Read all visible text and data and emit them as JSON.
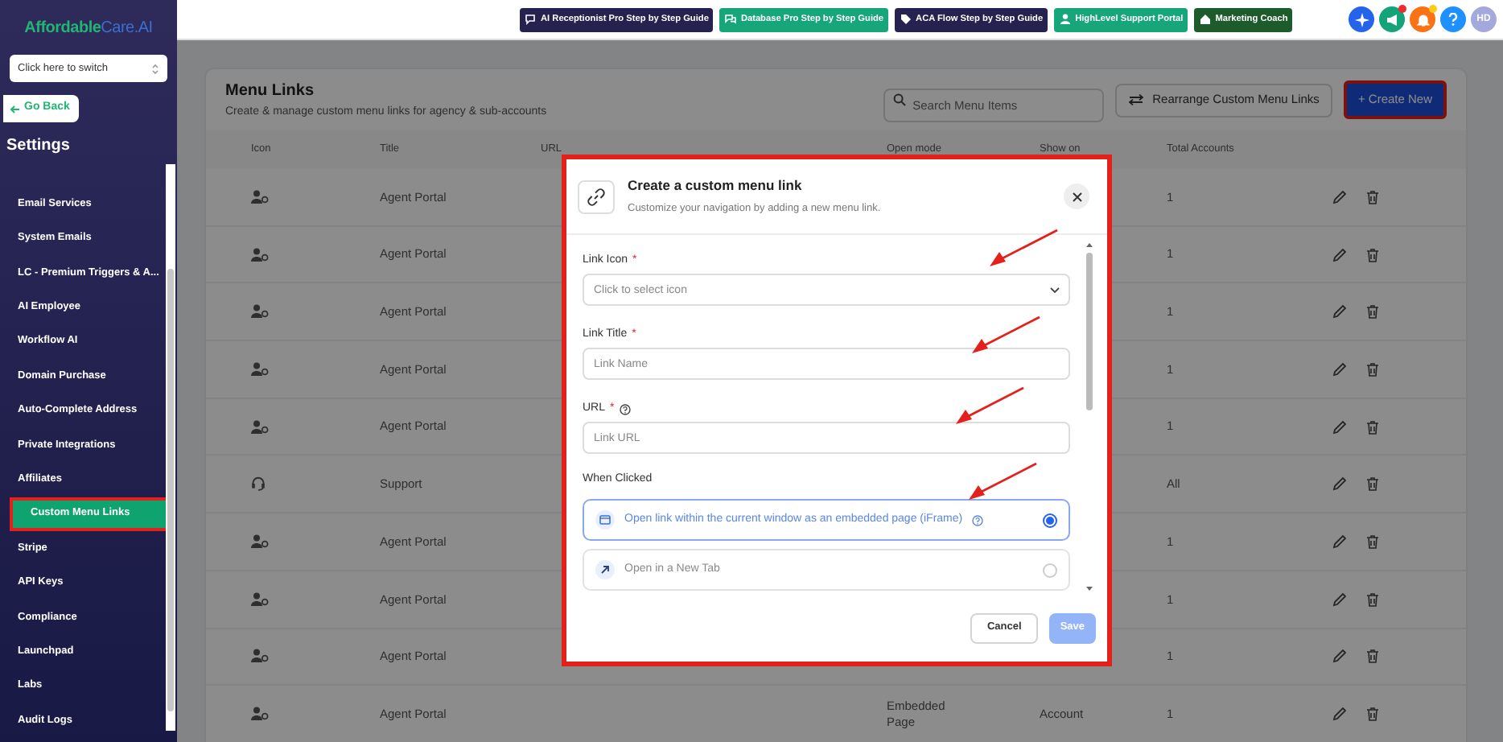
{
  "sidebar": {
    "logo": {
      "part_1": "Affordable",
      "part_2": "Care.AI"
    },
    "switcher": {
      "placeholder": "Click here to switch"
    },
    "back_button": "Go Back",
    "heading": "Settings",
    "items": [
      {
        "label": "Email Services",
        "selected": false
      },
      {
        "label": "System Emails",
        "selected": false
      },
      {
        "label": "LC - Premium Triggers & A...",
        "selected": false
      },
      {
        "label": "AI Employee",
        "selected": false
      },
      {
        "label": "Workflow AI",
        "selected": false
      },
      {
        "label": "Domain Purchase",
        "selected": false
      },
      {
        "label": "Auto-Complete Address",
        "selected": false
      },
      {
        "label": "Private Integrations",
        "selected": false
      },
      {
        "label": "Affiliates",
        "selected": false
      },
      {
        "label": "Custom Menu Links",
        "selected": true
      },
      {
        "label": "Stripe",
        "selected": false
      },
      {
        "label": "API Keys",
        "selected": false
      },
      {
        "label": "Compliance",
        "selected": false
      },
      {
        "label": "Launchpad",
        "selected": false
      },
      {
        "label": "Labs",
        "selected": false
      },
      {
        "label": "Audit Logs",
        "selected": false
      }
    ]
  },
  "top_bar": {
    "guides": [
      {
        "label": "AI Receptionist Pro Step by Step Guide",
        "kind": "chat",
        "color": "#25224f"
      },
      {
        "label": "Database Pro Step by Step Guide",
        "kind": "chats",
        "color": "#17a57a"
      },
      {
        "label": "ACA Flow Step by Step Guide",
        "kind": "tag",
        "color": "#25224f"
      },
      {
        "label": "HighLevel Support Portal",
        "kind": "person",
        "color": "#17a57a"
      },
      {
        "label": "Marketing Coach",
        "kind": "home",
        "color": "#1d5a2c"
      }
    ],
    "avatar": "HD"
  },
  "page": {
    "title": "Menu Links",
    "subtitle": "Create & manage custom menu links for agency & sub-accounts",
    "search": {
      "placeholder": "Search Menu Items"
    },
    "rearrange_button": "Rearrange Custom Menu Links",
    "create_button": "+ Create New",
    "table": {
      "columns": [
        "Icon",
        "Title",
        "URL",
        "Open mode",
        "Show on",
        "Total Accounts"
      ],
      "rows": [
        {
          "kind": "agent",
          "title": "Agent Portal",
          "total": "1"
        },
        {
          "kind": "agent",
          "title": "Agent Portal",
          "total": "1"
        },
        {
          "kind": "agent",
          "title": "Agent Portal",
          "total": "1"
        },
        {
          "kind": "agent",
          "title": "Agent Portal",
          "total": "1"
        },
        {
          "kind": "agent",
          "title": "Agent Portal",
          "total": "1"
        },
        {
          "kind": "support",
          "title": "Support",
          "total": "All"
        },
        {
          "kind": "agent",
          "title": "Agent Portal",
          "total": "1"
        },
        {
          "kind": "agent",
          "title": "Agent Portal",
          "total": "1"
        },
        {
          "kind": "agent",
          "title": "Agent Portal",
          "total": "1"
        },
        {
          "kind": "agent",
          "title": "Agent Portal",
          "open_mode": "Embedded Page",
          "show_on": "Account",
          "total": "1"
        }
      ]
    }
  },
  "dialog": {
    "title": "Create a custom menu link",
    "subtitle": "Customize your navigation by adding a new menu link.",
    "fields": [
      {
        "label": "Link Icon",
        "required": "*",
        "kind": "select",
        "placeholder": "Click to select icon"
      },
      {
        "label": "Link Title",
        "required": "*",
        "kind": "text",
        "placeholder": "Link Name"
      },
      {
        "label": "URL",
        "required": "*",
        "kind": "text",
        "help": true,
        "placeholder": "Link URL"
      }
    ],
    "when_clicked": {
      "label": "When Clicked",
      "options": [
        {
          "label": "Open link within the current window as an embedded page (iFrame)",
          "kind": "embed",
          "help": true,
          "selected": true
        },
        {
          "label": "Open in a New Tab",
          "kind": "newtab",
          "help": false,
          "selected": false
        }
      ]
    },
    "cancel_button": "Cancel",
    "save_button": "Save"
  }
}
